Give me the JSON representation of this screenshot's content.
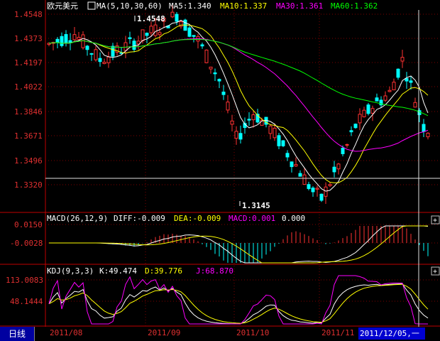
{
  "symbol": "欧元美元",
  "ma_legend": {
    "ma_label": "MA(5,10,30,60)",
    "ma5": "MA5:1.340",
    "ma10": "MA10:1.337",
    "ma30": "MA30:1.361",
    "ma60": "MA60:1.362"
  },
  "macd_legend": {
    "label": "MACD(26,12,9)",
    "diff": "DIFF:-0.009",
    "dea": "DEA:-0.009",
    "macd": "MACD:0.001",
    "extra": "0.000"
  },
  "kdj_legend": {
    "label": "KDJ(9,3,3)",
    "k": "K:49.474",
    "d": "D:39.776",
    "j": "J:68.870"
  },
  "price_axis": [
    "1.4548",
    "1.4373",
    "1.4197",
    "1.4022",
    "1.3846",
    "1.3671",
    "1.3496",
    "1.3320"
  ],
  "macd_axis": [
    "0.0150",
    "-0.0028"
  ],
  "kdj_axis": [
    "113.0083",
    "48.1444"
  ],
  "x_axis": [
    "2011/08",
    "2011/09",
    "2011/10",
    "2011/11"
  ],
  "period_tab": "日线",
  "cursor_date": "2011/12/05,一",
  "annotations": {
    "high": "1.4548",
    "low": "1.3145"
  },
  "colors": {
    "up": "#ff3232",
    "down": "#00ffff",
    "ma5": "#ffffff",
    "ma10": "#ffff00",
    "ma30": "#ff00ff",
    "ma60": "#00ff00",
    "axis": "#c00000"
  },
  "chart_data": {
    "type": "candlestick",
    "series": [
      {
        "name": "MA5",
        "values": [
          1.34
        ]
      },
      {
        "name": "MA10",
        "values": [
          1.337
        ]
      },
      {
        "name": "MA30",
        "values": [
          1.361
        ]
      },
      {
        "name": "MA60",
        "values": [
          1.362
        ]
      }
    ],
    "ylim": [
      1.3145,
      1.4548
    ],
    "macd": {
      "DIFF": -0.009,
      "DEA": -0.009,
      "MACD": 0.001
    },
    "kdj": {
      "K": 49.474,
      "D": 39.776,
      "J": 68.87
    }
  }
}
